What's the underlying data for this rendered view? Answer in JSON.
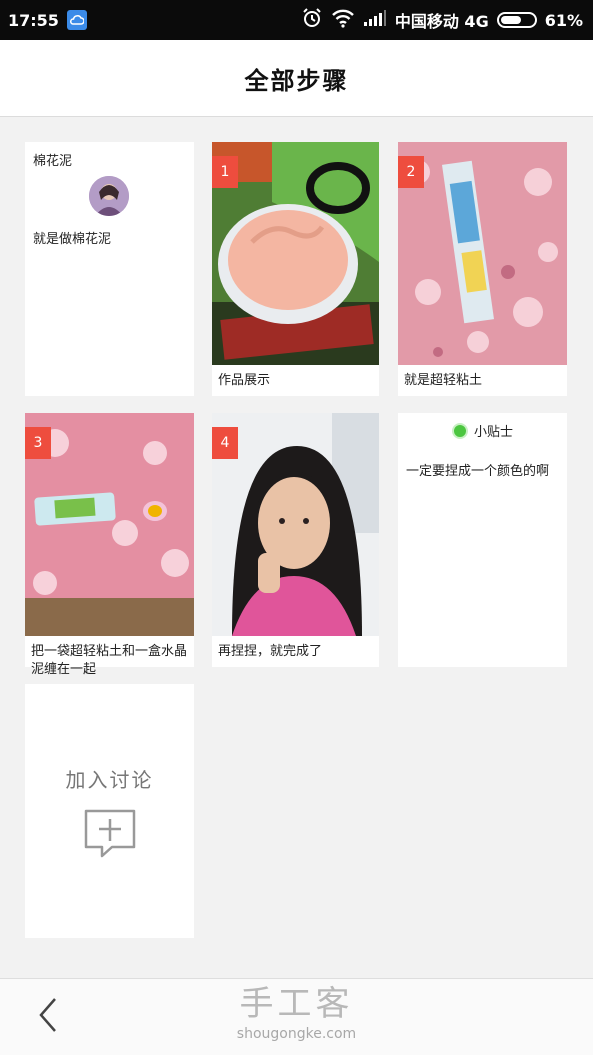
{
  "status_bar": {
    "time": "17:55",
    "carrier": "中国移动 4G",
    "battery_text": "61%",
    "battery_level": 0.61
  },
  "header": {
    "title": "全部步骤"
  },
  "intro_card": {
    "title": "棉花泥",
    "description": "就是做棉花泥"
  },
  "steps": [
    {
      "number": "1",
      "caption": "作品展示"
    },
    {
      "number": "2",
      "caption": "就是超轻粘土"
    },
    {
      "number": "3",
      "caption": "把一袋超轻粘土和一盒水晶泥缠在一起"
    },
    {
      "number": "4",
      "caption": "再捏捏，就完成了"
    }
  ],
  "tip_card": {
    "title": "小贴士",
    "text": "一定要捏成一个颜色的啊"
  },
  "join_card": {
    "label": "加入讨论"
  },
  "bottom_bar": {
    "brand_cn": "手工客",
    "brand_en": "shougongke.com"
  },
  "icons": {
    "back": "chevron-left-icon",
    "add_comment": "comment-plus-icon",
    "cloud": "cloud-icon",
    "alarm": "alarm-icon",
    "wifi": "wifi-icon",
    "signal": "signal-icon",
    "battery": "battery-icon"
  },
  "colors": {
    "badge": "#ee4d3e",
    "tip_dot": "#4cc640",
    "header_bg": "#ffffff",
    "page_bg": "#f2f2f2"
  }
}
